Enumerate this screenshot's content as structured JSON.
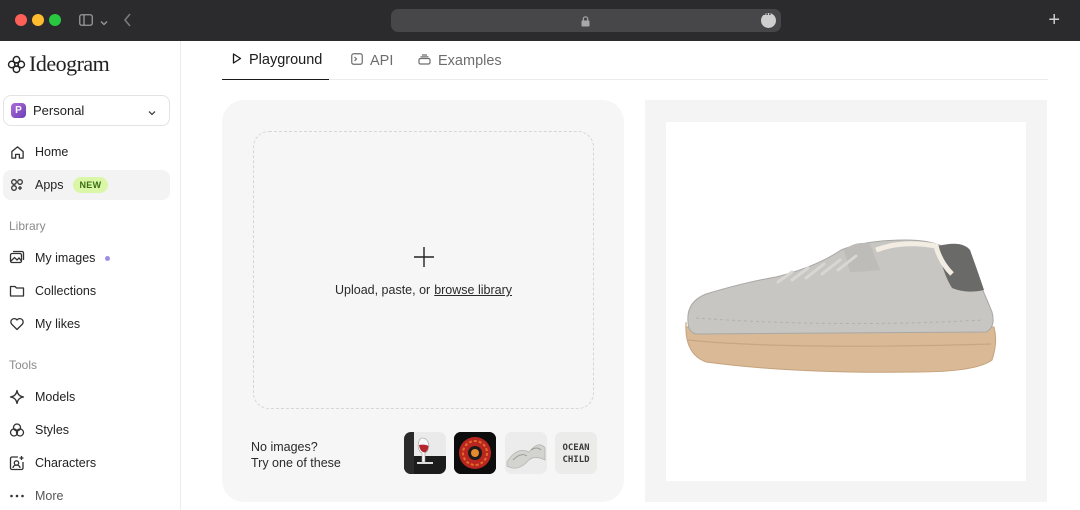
{
  "browser": {
    "address_bar": ""
  },
  "sidebar": {
    "logo_text": "Ideogram",
    "workspace": {
      "initial": "P",
      "name": "Personal"
    },
    "items": [
      {
        "label": "Home",
        "icon": "home-icon"
      },
      {
        "label": "Apps",
        "icon": "apps-icon",
        "badge": "NEW"
      }
    ],
    "library_label": "Library",
    "library_items": [
      {
        "label": "My images",
        "icon": "images-icon"
      },
      {
        "label": "Collections",
        "icon": "folder-icon"
      },
      {
        "label": "My likes",
        "icon": "heart-icon"
      }
    ],
    "tools_label": "Tools",
    "tools_items": [
      {
        "label": "Models",
        "icon": "sparkle-icon"
      },
      {
        "label": "Styles",
        "icon": "styles-icon"
      },
      {
        "label": "Characters",
        "icon": "character-icon"
      },
      {
        "label": "More",
        "icon": "more-icon"
      }
    ]
  },
  "tabs": [
    {
      "label": "Playground",
      "icon": "play-icon",
      "active": true
    },
    {
      "label": "API",
      "icon": "terminal-icon",
      "active": false
    },
    {
      "label": "Examples",
      "icon": "stack-icon",
      "active": false
    }
  ],
  "upload": {
    "text": "Upload, paste, or",
    "link": "browse library",
    "try_line1": "No images?",
    "try_line2": "Try one of these",
    "samples": [
      {
        "name": "sample-wine-glass"
      },
      {
        "name": "sample-red-emblem"
      },
      {
        "name": "sample-white-sculpture"
      },
      {
        "name": "sample-ocean-child-logo",
        "text": "OCEAN CHILD"
      }
    ]
  },
  "preview": {
    "image": "sneaker-product-photo"
  },
  "colors": {
    "accent_new_badge": "#d9f7a6",
    "workspace_avatar": "#8e52c9",
    "unread_dot": "#a08de8"
  }
}
